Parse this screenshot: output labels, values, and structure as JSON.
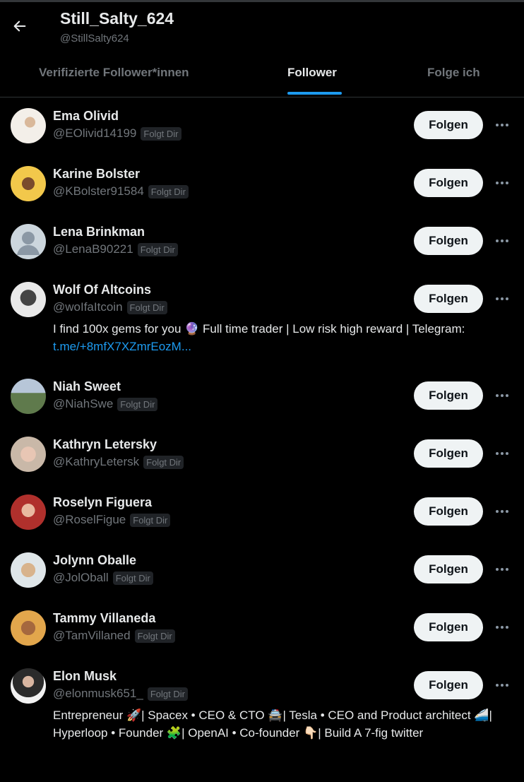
{
  "header": {
    "title": "Still_Salty_624",
    "subtitle": "@StillSalty624",
    "back_icon": "arrow-left-icon"
  },
  "tabs": [
    {
      "label": "Verifizierte Follower*innen",
      "active": false
    },
    {
      "label": "Follower",
      "active": true
    },
    {
      "label": "Folge ich",
      "active": false
    }
  ],
  "follow_label": "Folgen",
  "follows_you_label": "Folgt Dir",
  "users": [
    {
      "name": "Ema Olivid",
      "handle": "@EOlivid14199",
      "avatar_icon": "profile-photo"
    },
    {
      "name": "Karine Bolster",
      "handle": "@KBolster91584",
      "avatar_icon": "profile-photo"
    },
    {
      "name": "Lena Brinkman",
      "handle": "@LenaB90221",
      "avatar_icon": "default-avatar-icon"
    },
    {
      "name": "Wolf Of Altcoins",
      "handle": "@woIfaItcoin",
      "avatar_icon": "profile-photo",
      "bio_text": "I find 100x gems for you 🔮 Full time trader | Low risk high reward | Telegram: ",
      "bio_link": "t.me/+8mfX7XZmrEozM..."
    },
    {
      "name": "Niah Sweet",
      "handle": "@NiahSwe",
      "avatar_icon": "profile-photo"
    },
    {
      "name": "Kathryn Letersky",
      "handle": "@KathryLetersk",
      "avatar_icon": "profile-photo"
    },
    {
      "name": "Roselyn Figuera",
      "handle": "@RoselFigue",
      "avatar_icon": "profile-photo"
    },
    {
      "name": "Jolynn Oballe",
      "handle": "@JolOball",
      "avatar_icon": "profile-photo"
    },
    {
      "name": "Tammy Villaneda",
      "handle": "@TamVillaned",
      "avatar_icon": "profile-photo"
    },
    {
      "name": "Elon Musk",
      "handle": "@elonmusk651_",
      "avatar_icon": "profile-photo",
      "bio_text": "Entrepreneur 🚀| Spacex • CEO & CTO 🚔| Tesla • CEO and Product architect 🚄| Hyperloop • Founder 🧩| OpenAI • Co-founder 👇🏻| Build A 7-fig twitter"
    }
  ],
  "colors": {
    "background": "#000000",
    "text_primary": "#e7e9ea",
    "text_secondary": "#71767b",
    "accent": "#1d9bf0",
    "button_bg": "#eff3f4"
  }
}
